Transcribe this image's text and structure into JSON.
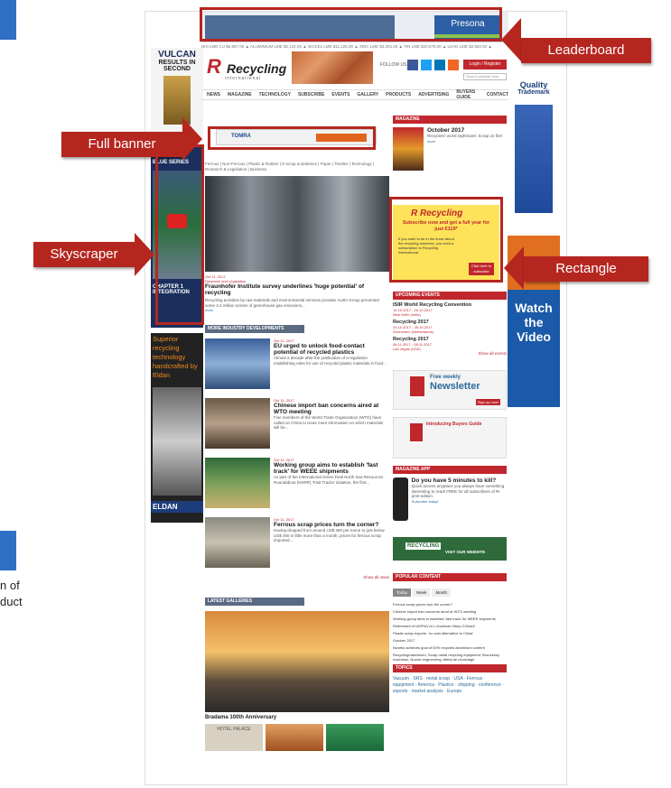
{
  "left_fragment": {
    "text": "n of\nduct"
  },
  "callouts": {
    "leaderboard": "Leaderboard",
    "full_banner": "Full banner",
    "skyscraper": "Skyscraper",
    "rectangle": "Rectangle"
  },
  "site": {
    "logo": "Recycling",
    "logo_sub": "international",
    "follow_us": "FOLLOW US",
    "login": "Login / Register",
    "search_placeholder": "Search website here",
    "nav": [
      "NEWS",
      "MAGAZINE",
      "TECHNOLOGY",
      "SUBSCRIBE",
      "EVENTS",
      "GALLERY",
      "PRODUCTS",
      "ADVERTISING",
      "BUYERS GUIDE",
      "CONTACT"
    ],
    "leaderboard_brand": "Presona",
    "full_banner_brand": "TOMRA",
    "categories": "Ferrous | Non-Ferrous | Plastic & Rubber | E-scrap & Batteries | Paper | Textiles | Technology | Research & Legislation | Business"
  },
  "ads_left": {
    "vulcan": "VULCAN",
    "vulcan_sub": "RESULTS IN",
    "vulcan_sub2": "SECOND",
    "bhs": "BHS",
    "bhs_sub": "BLUE SERIES",
    "chapter": "CHAPTER 1",
    "integration": "INTEGRATION",
    "elder_text": "Superior recycling technology handcrafted by Eldan",
    "eldan": "ELDAN"
  },
  "ads_right": {
    "quality": "Quality",
    "trademark": "Trademark",
    "watch": "Watch the Video"
  },
  "featured": {
    "date": "Oct 11, 2017",
    "category": "Research and Legislation",
    "title": "Fraunhofer Institute survey underlines 'huge potential' of recycling",
    "body": "Recycling activities by raw materials and environmental services provider ALBA Group prevented some 4.3 million tonnes of greenhouse gas emissions...",
    "more": "more"
  },
  "more_dev": {
    "heading": "MORE INDUSTRY DEVELOPMENTS",
    "items": [
      {
        "date": "Oct 11, 2017",
        "title": "EU urged to unlock food-contact potential of recycled plastics",
        "body": "Almost a decade after the publication of a regulation establishing rules for use of recycled plastic materials in food...",
        "more": "more"
      },
      {
        "date": "Oct 11, 2017",
        "title": "Chinese import ban concerns aired at WTO meeting",
        "body": "Five members of the World Trade Organization (WTO) have called on China to issue more information on which materials will be...",
        "more": "more"
      },
      {
        "date": "Oct 11, 2017",
        "title": "Working group aims to establish 'fast track' for WEEE shipments",
        "body": "As part of the International Green Deal North Sea Resources Roundabout (NSRR) 'Fast Tracks' initiative, the first...",
        "more": "more"
      },
      {
        "date": "Oct 11, 2017",
        "title": "Ferrous scrap prices turn the corner?",
        "body": "Having dropped from around US$ 360 per tonne to just below US$ 300 in little more than a month, prices for ferrous scrap imported...",
        "more": "more"
      }
    ],
    "show_all": "Show all news"
  },
  "gallery": {
    "heading": "LATEST GALLERIES",
    "caption": "Bradama 100th Anniversary",
    "hotel": "HOTEL PALACE"
  },
  "sidebar": {
    "magazine_heading": "MAGAZINE",
    "magazine_issue": "October 2017",
    "magazine_blurb": "Recyclers' worst nightmare: Scrap on fire!",
    "magazine_more": "more",
    "rect_logo": "Recycling",
    "rect_offer": "Subscribe now and get a full year for just €119*",
    "rect_body": "If you want to be in the know about the recycling business, you need a subscription to Recycling International.",
    "rect_cta": "Click here to subscribe",
    "events_heading": "UPCOMING EVENTS",
    "events": [
      {
        "title": "ISIR World Recycling Convention",
        "dates": "14.10.2017 - 16.10.2017",
        "place": "New Delhi (India)"
      },
      {
        "title": "Recycling 2017",
        "dates": "24.10.2017 - 26.10.2017",
        "place": "Gorinchem (Netherlands)"
      },
      {
        "title": "Recycling 2017",
        "dates": "06.11.2017 - 08.11.2017",
        "place": "Las Vegas (USA)"
      }
    ],
    "show_events": "Show all events",
    "newsletter_1": "Free weekly",
    "newsletter_2": "Newsletter",
    "newsletter_cta": "Sign up now!",
    "buyers_guide": "Introducing Buyers Guide",
    "app_heading": "MAGAZINE APP",
    "app_title": "Do you have 5 minutes to kill?",
    "app_body": "Quick access anyplace you always have something interesting to read! FREE for all subscribers of RI print edition.",
    "app_cta": "Subscribe today!",
    "recycling_banner": "RECYCLING",
    "recycling_banner_sub": "VISIT OUR WEBSITE",
    "popular_heading": "POPULAR CONTENT",
    "popular_tabs": [
      "Today",
      "Week",
      "Month"
    ],
    "popular": [
      "Ferrous scrap prices turn the corner?",
      "Chinese import ban concerns aired at WTO meeting",
      "Working group aims to establish 'fast track' for WEEE shipments",
      "Retirement of UKPHA v4 v chairman Vikky O'Ahadi",
      "Plastic scrap exports: 'no sold alternative to China'",
      "October 2017",
      "Novelis achieves goal of 50% recycled aluminium content",
      "Recyclingmaschinen, Scrap metal recycling equipment, Bronzekey machines, Nozzle engineering, Metal de récuiclage"
    ],
    "topics_heading": "TOPICS",
    "topics": "Vacuum · SRS · metal scrap · USA · Ferrous · equipment · America · Plastics · shipping · conference · exports · market analysis · Europe"
  },
  "colors": {
    "callout": "#b5261f",
    "brand_red": "#c0272d",
    "nav_blue": "#5a6a82",
    "slide_blue": "#2f6fc4"
  }
}
